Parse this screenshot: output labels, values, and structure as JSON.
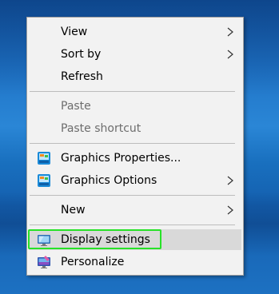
{
  "context_menu": {
    "items": [
      {
        "label": "View",
        "has_submenu": true
      },
      {
        "label": "Sort by",
        "has_submenu": true
      },
      {
        "label": "Refresh"
      },
      {
        "label": "Paste",
        "disabled": true
      },
      {
        "label": "Paste shortcut",
        "disabled": true
      },
      {
        "label": "Graphics Properties...",
        "icon": "intel-graphics-icon"
      },
      {
        "label": "Graphics Options",
        "icon": "intel-graphics-icon",
        "has_submenu": true
      },
      {
        "label": "New",
        "has_submenu": true
      },
      {
        "label": "Display settings",
        "icon": "display-icon",
        "highlighted": true
      },
      {
        "label": "Personalize",
        "icon": "personalize-icon"
      }
    ]
  },
  "colors": {
    "menu_bg": "#f2f2f2",
    "highlight_bg": "#d9d9d9",
    "focus_outline": "#27e227",
    "disabled_text": "#6d6d6d",
    "desktop": "#1f73c6"
  }
}
